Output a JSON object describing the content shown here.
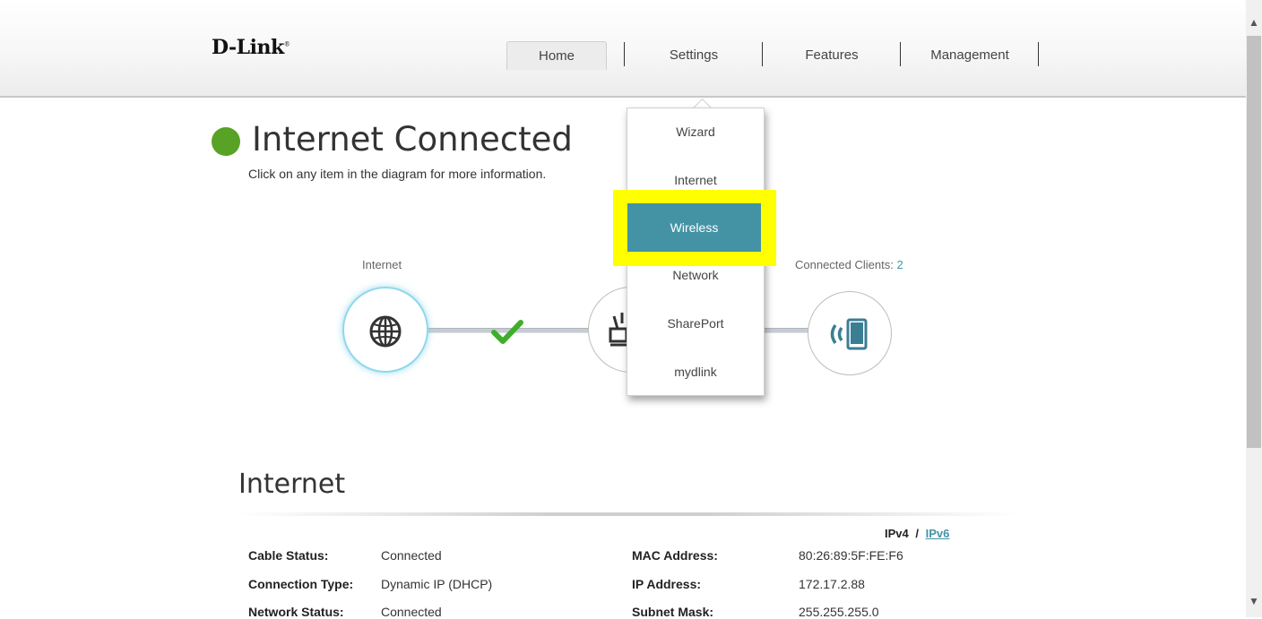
{
  "header": {
    "logo": "D-Link",
    "nav": {
      "home": "Home",
      "settings": "Settings",
      "features": "Features",
      "management": "Management"
    }
  },
  "status": {
    "title": "Internet Connected",
    "subtitle": "Click on any item in the diagram for more information.",
    "color": "#58a225"
  },
  "diagram": {
    "internet_label": "Internet",
    "clients_label": "Connected Clients:",
    "clients_count": "2"
  },
  "settings_menu": {
    "items": [
      "Wizard",
      "Internet",
      "Wireless",
      "Network",
      "SharePort",
      "mydlink"
    ],
    "selected": "Wireless",
    "accent": "#4393a5",
    "highlight_color": "#ffff00"
  },
  "internet_section": {
    "title": "Internet",
    "ipv4": "IPv4",
    "separator": "/",
    "ipv6": "IPv6",
    "left": [
      {
        "label": "Cable Status:",
        "value": "Connected"
      },
      {
        "label": "Connection Type:",
        "value": "Dynamic IP (DHCP)"
      },
      {
        "label": "Network Status:",
        "value": "Connected"
      }
    ],
    "right": [
      {
        "label": "MAC Address:",
        "value": "80:26:89:5F:FE:F6"
      },
      {
        "label": "IP Address:",
        "value": "172.17.2.88"
      },
      {
        "label": "Subnet Mask:",
        "value": "255.255.255.0"
      }
    ]
  }
}
